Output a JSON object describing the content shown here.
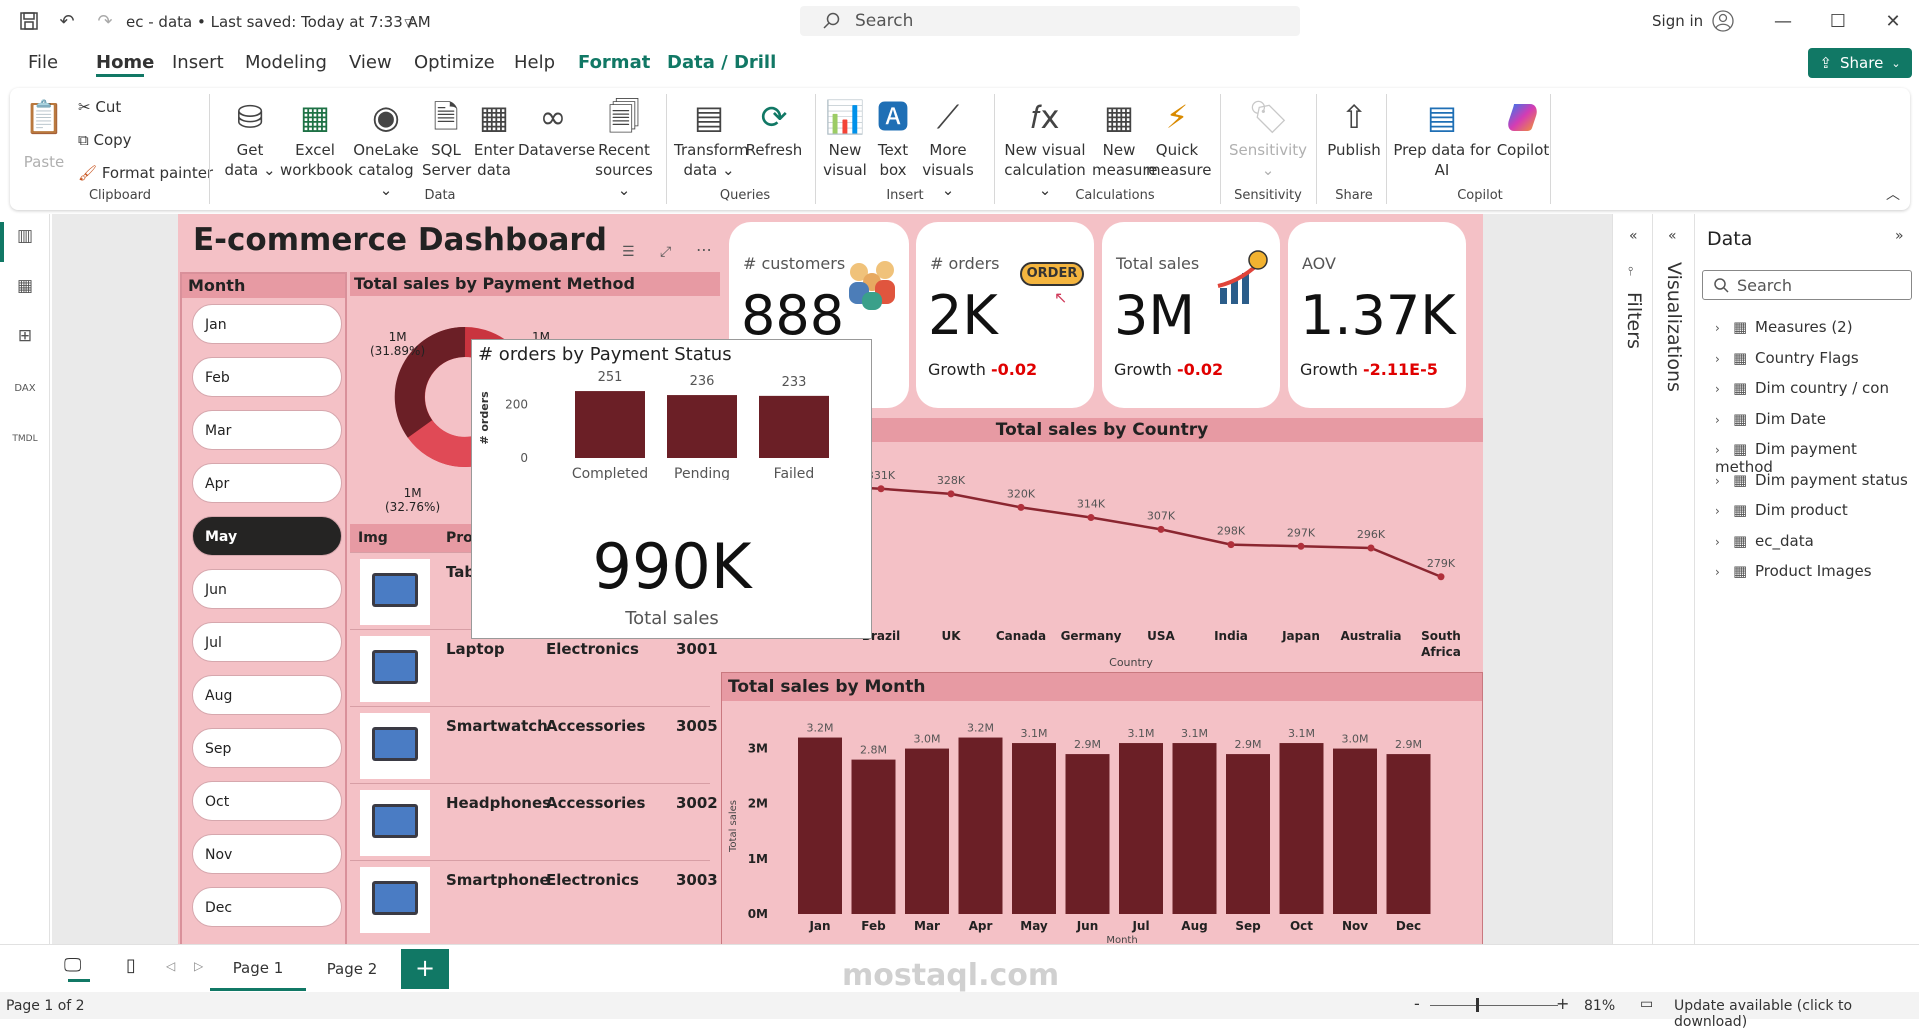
{
  "titlebar": {
    "doc_title": "ec - data  •  Last saved: Today at 7:33 AM",
    "search_placeholder": "Search",
    "signin": "Sign in"
  },
  "menu": [
    "File",
    "Home",
    "Insert",
    "Modeling",
    "View",
    "Optimize",
    "Help",
    "Format",
    "Data / Drill"
  ],
  "share": "Share",
  "ribbon": {
    "clipboard": {
      "paste": "Paste",
      "cut": "Cut",
      "copy": "Copy",
      "format_painter": "Format painter",
      "label": "Clipboard"
    },
    "data": {
      "get_data": "Get data ⌄",
      "excel": "Excel workbook",
      "onelake": "OneLake catalog ⌄",
      "sql": "SQL Server",
      "enter": "Enter data",
      "dataverse": "Dataverse",
      "recent": "Recent sources ⌄",
      "label": "Data"
    },
    "queries": {
      "transform": "Transform data ⌄",
      "refresh": "Refresh",
      "label": "Queries"
    },
    "insert": {
      "new_visual": "New visual",
      "text_box": "Text box",
      "more_visuals": "More visuals ⌄",
      "label": "Insert"
    },
    "calculations": {
      "new_visual_calc": "New visual calculation ⌄",
      "new_measure": "New measure",
      "quick_measure": "Quick measure",
      "label": "Calculations"
    },
    "sensitivity": {
      "btn": "Sensitivity ⌄",
      "label": "Sensitivity"
    },
    "share": {
      "publish": "Publish",
      "label": "Share"
    },
    "copilot": {
      "prep": "Prep data for AI",
      "copilot": "Copilot",
      "label": "Copilot"
    }
  },
  "report": {
    "title": "E-commerce Dashboard",
    "month_header": "Month",
    "months": [
      "Jan",
      "Feb",
      "Mar",
      "Apr",
      "May",
      "Jun",
      "Jul",
      "Aug",
      "Sep",
      "Oct",
      "Nov",
      "Dec"
    ],
    "selected_month": "May",
    "payment_method_title": "Total sales by Payment Method",
    "donut_labels": [
      {
        "value": "1M",
        "pct": "(31.89%)"
      },
      {
        "value": "1M",
        "pct": "(32.76%)"
      },
      {
        "value": "1M",
        "pct": ""
      }
    ],
    "cards": [
      {
        "label": "# customers",
        "value": "888",
        "growth_label": "",
        "growth": ""
      },
      {
        "label": "# orders",
        "value": "2K",
        "growth_label": "Growth",
        "growth": "-0.02"
      },
      {
        "label": "Total sales",
        "value": "3M",
        "growth_label": "Growth",
        "growth": "-0.02"
      },
      {
        "label": "AOV",
        "value": "1.37K",
        "growth_label": "Growth",
        "growth": "-2.11E-5"
      }
    ],
    "order_badge": "ORDER",
    "country_title": "Total sales by Country",
    "country_axis": "Country",
    "products_header": {
      "img": "Img",
      "product": "Prod"
    },
    "products": [
      {
        "name": "Tab",
        "category": "",
        "id": ""
      },
      {
        "name": "Laptop",
        "category": "Electronics",
        "id": "3001"
      },
      {
        "name": "Smartwatch",
        "category": "Accessories",
        "id": "3005"
      },
      {
        "name": "Headphones",
        "category": "Accessories",
        "id": "3002"
      },
      {
        "name": "Smartphone",
        "category": "Electronics",
        "id": "3003"
      }
    ],
    "month_chart_title": "Total sales by Month",
    "tooltip": {
      "title": "# orders by Payment Status",
      "total_value": "990K",
      "total_label": "Total sales"
    }
  },
  "panes": {
    "filters": "Filters",
    "visualizations": "Visualizations",
    "data_title": "Data",
    "search_placeholder": "Search",
    "tree": [
      "Measures (2)",
      "Country Flags",
      "Dim country / con",
      "Dim Date",
      "Dim payment method",
      "Dim payment status",
      "Dim product",
      "ec_data",
      "Product Images"
    ]
  },
  "pages": {
    "tabs": [
      "Page 1",
      "Page 2"
    ],
    "active": "Page 1"
  },
  "status": {
    "page": "Page 1 of 2",
    "zoom": "81%",
    "update": "Update available (click to download)"
  },
  "watermark": "mostaql.com",
  "colors": {
    "accent": "#117865",
    "bar": "#6b1f26",
    "report_bg": "#f4c1c6",
    "header_band": "#e79aa3",
    "negative": "#e00000"
  },
  "chart_data": [
    {
      "type": "line",
      "title": "Total sales by Country",
      "xlabel": "Country",
      "categories": [
        "Brazil",
        "UK",
        "Canada",
        "Germany",
        "USA",
        "India",
        "Japan",
        "Australia",
        "South Africa"
      ],
      "values": [
        331,
        328,
        320,
        314,
        307,
        298,
        297,
        296,
        279
      ],
      "data_labels": [
        "331K",
        "328K",
        "320K",
        "314K",
        "307K",
        "298K",
        "297K",
        "296K",
        "279K"
      ]
    },
    {
      "type": "bar",
      "title": "Total sales by Month",
      "xlabel": "Month",
      "ylabel": "Total sales",
      "categories": [
        "Jan",
        "Feb",
        "Mar",
        "Apr",
        "May",
        "Jun",
        "Jul",
        "Aug",
        "Sep",
        "Oct",
        "Nov",
        "Dec"
      ],
      "values": [
        3.2,
        2.8,
        3.0,
        3.2,
        3.1,
        2.9,
        3.1,
        3.1,
        2.9,
        3.1,
        3.0,
        2.9
      ],
      "data_labels": [
        "3.2M",
        "2.8M",
        "3.0M",
        "3.2M",
        "3.1M",
        "2.9M",
        "3.1M",
        "3.1M",
        "2.9M",
        "3.1M",
        "3.0M",
        "2.9M"
      ],
      "yticks": [
        "0M",
        "1M",
        "2M",
        "3M"
      ],
      "ylim": [
        0,
        3.5
      ]
    },
    {
      "type": "bar",
      "title": "# orders by Payment Status",
      "ylabel": "# orders",
      "categories": [
        "Completed",
        "Pending",
        "Failed"
      ],
      "values": [
        251,
        236,
        233
      ],
      "yticks": [
        "0",
        "200"
      ],
      "ylim": [
        0,
        300
      ]
    },
    {
      "type": "pie",
      "title": "Total sales by Payment Method",
      "values": [
        31.89,
        32.76,
        35.35
      ]
    }
  ]
}
